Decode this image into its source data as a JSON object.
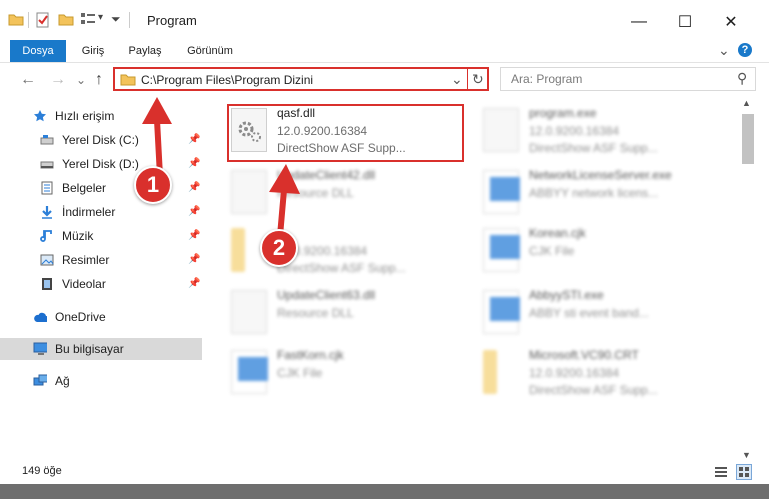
{
  "window": {
    "title": "Program",
    "minimize_glyph": "—",
    "maximize_glyph": "☐",
    "close_glyph": "✕"
  },
  "ribbon": {
    "tabs": [
      {
        "label": "Dosya",
        "active": true
      },
      {
        "label": "Giriş"
      },
      {
        "label": "Paylaş"
      },
      {
        "label": "Görünüm"
      }
    ],
    "expand_glyph": "⌄",
    "help_glyph": "?"
  },
  "nav": {
    "back": "←",
    "forward": "→",
    "history": "⌄",
    "up": "↑",
    "address": "C:\\Program Files\\Program Dizini",
    "refresh": "↻",
    "dropdown": "⌄",
    "search_placeholder": "Ara: Program",
    "search_glyph": "⚲"
  },
  "sidebar": {
    "items": [
      {
        "label": "Hızlı erişim",
        "icon": "star-icon",
        "pinned": false
      },
      {
        "label": "Yerel Disk (C:)",
        "icon": "drive-icon",
        "pinned": true
      },
      {
        "label": "Yerel Disk (D:)",
        "icon": "drive-icon",
        "pinned": true
      },
      {
        "label": "Belgeler",
        "icon": "documents-icon",
        "pinned": true
      },
      {
        "label": "İndirmeler",
        "icon": "download-icon",
        "pinned": true
      },
      {
        "label": "Müzik",
        "icon": "music-icon",
        "pinned": true
      },
      {
        "label": "Resimler",
        "icon": "pictures-icon",
        "pinned": true
      },
      {
        "label": "Videolar",
        "icon": "video-icon",
        "pinned": true
      },
      {
        "label": "OneDrive",
        "icon": "cloud-icon",
        "pinned": false
      },
      {
        "label": "Bu bilgisayar",
        "icon": "computer-icon",
        "pinned": false,
        "selected": true
      },
      {
        "label": "Ağ",
        "icon": "network-icon",
        "pinned": false
      }
    ]
  },
  "files": [
    {
      "name": "qasf.dll",
      "line2": "12.0.9200.16384",
      "line3": "DirectShow ASF Supp...",
      "icon": "dll-gear-icon",
      "highlighted": true
    },
    {
      "name": "program.exe",
      "line2": "12.0.9200.16384",
      "line3": "DirectShow ASF Supp...",
      "icon": "exe-icon"
    },
    {
      "name": "UpdateClient42.dll",
      "line2": "Resource DLL",
      "line3": "",
      "icon": "dll-gear-icon"
    },
    {
      "name": "NetworkLicenseServer.exe",
      "line2": "ABBYY network licens...",
      "line3": "",
      "icon": "app-window-icon"
    },
    {
      "name": "",
      "line2": "12.0.9200.16384",
      "line3": "DirectShow ASF Supp...",
      "icon": "folder-icon"
    },
    {
      "name": "Korean.cjk",
      "line2": "CJK File",
      "line3": "",
      "icon": "blank-file-icon"
    },
    {
      "name": "UpdateClient63.dll",
      "line2": "Resource DLL",
      "line3": "",
      "icon": "dll-gear-icon"
    },
    {
      "name": "AbbyySTI.exe",
      "line2": "ABBY sti event band...",
      "line3": "",
      "icon": "app-window-icon"
    },
    {
      "name": "FastKorn.cjk",
      "line2": "CJK File",
      "line3": "",
      "icon": "blank-file-icon"
    },
    {
      "name": "Microsoft.VC90.CRT",
      "line2": "12.0.9200.16384",
      "line3": "DirectShow ASF Supp...",
      "icon": "folder-icon"
    }
  ],
  "annotations": {
    "badge1": "1",
    "badge2": "2",
    "accent": "#d9302c"
  },
  "status": {
    "count": "149 öğe"
  }
}
